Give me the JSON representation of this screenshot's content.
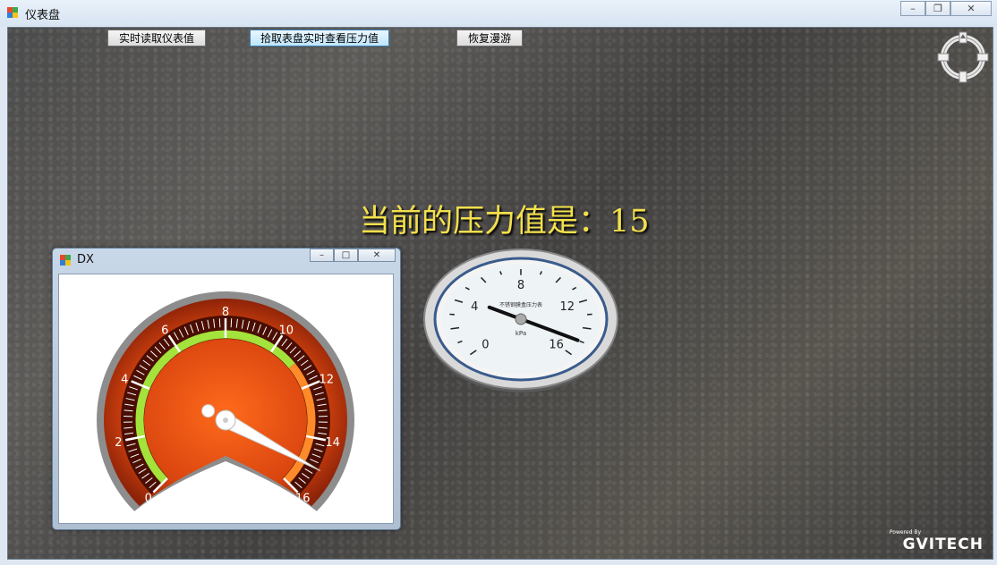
{
  "window": {
    "title": "仪表盘",
    "controls": [
      "minimize",
      "maximize",
      "close"
    ]
  },
  "toolbar": {
    "read_button": "实时读取仪表值",
    "pick_button": "拾取表盘实时查看压力值",
    "restore_button": "恢复漫游"
  },
  "overlay": {
    "pressure_text": "当前的压力值是：15",
    "text_color": "#f3e04c"
  },
  "gauge3d": {
    "value": 15,
    "min": 0,
    "max": 16,
    "labels": [
      "0",
      "4",
      "8",
      "12",
      "16"
    ],
    "caption": "不锈钢膜盒压力表",
    "unit": "kPa"
  },
  "dx_window": {
    "title": "DX",
    "gauge": {
      "value": 15,
      "min": 0,
      "max": 16,
      "labels": [
        "0",
        "2",
        "4",
        "6",
        "8",
        "10",
        "12",
        "14",
        "16"
      ],
      "green_range": [
        0,
        11
      ],
      "orange_range": [
        11,
        16
      ],
      "colors": {
        "green": "#a4e23c",
        "orange": "#ff8a2a",
        "face": "#e2561a",
        "rim": "#8d8d8d"
      }
    }
  },
  "logo": {
    "powered": "Powered By",
    "brand": "GVITECH"
  }
}
